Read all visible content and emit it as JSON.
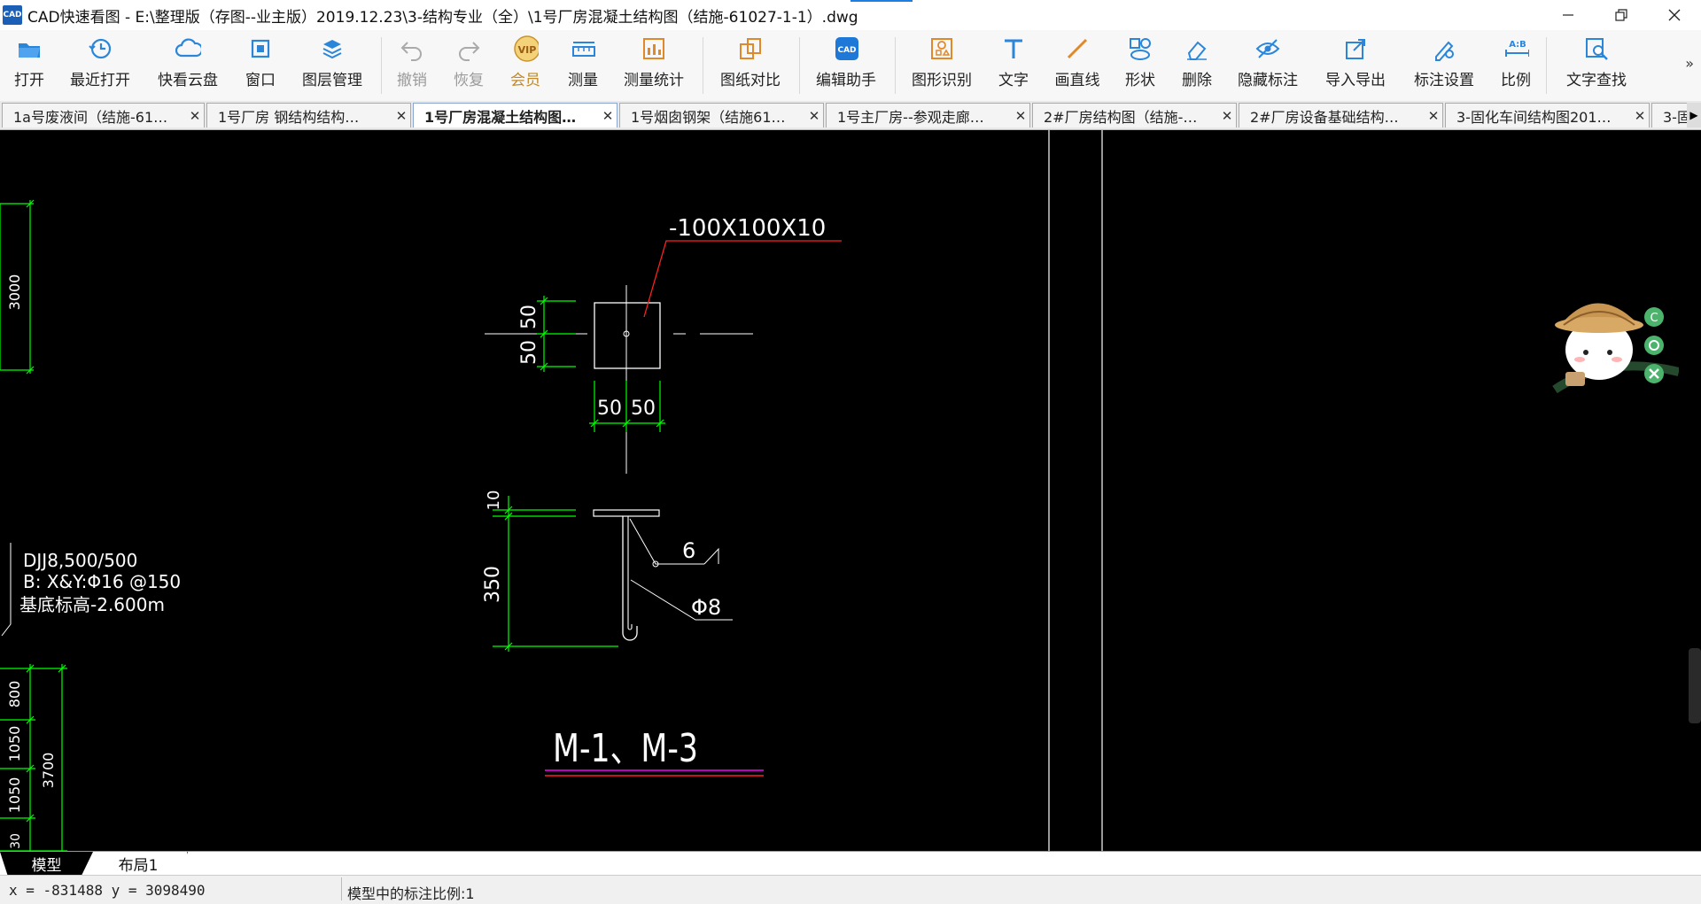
{
  "window": {
    "logo": "CAD",
    "title": "CAD快速看图 - E:\\整理版（存图--业主版）2019.12.23\\3-结构专业（全）\\1号厂房混凝土结构图（结施-61027-1-1）.dwg",
    "controls": [
      "minimize-icon",
      "restore-icon",
      "close-icon"
    ]
  },
  "toolbar": {
    "items": [
      {
        "label": "打开",
        "icon": "folder-open-icon",
        "enabled": true
      },
      {
        "label": "最近打开",
        "icon": "recent-clock-icon",
        "enabled": true
      },
      {
        "label": "快看云盘",
        "icon": "cloud-icon",
        "enabled": true
      },
      {
        "label": "窗口",
        "icon": "window-icon",
        "enabled": true
      },
      {
        "label": "图层管理",
        "icon": "layers-icon",
        "enabled": true
      },
      {
        "label": "撤销",
        "icon": "undo-icon",
        "enabled": false
      },
      {
        "label": "恢复",
        "icon": "redo-icon",
        "enabled": false
      },
      {
        "label": "会员",
        "icon": "vip-badge-icon",
        "badge": "VIP",
        "enabled": true
      },
      {
        "label": "测量",
        "icon": "ruler-icon",
        "enabled": true
      },
      {
        "label": "测量统计",
        "icon": "measure-stats-icon",
        "enabled": true
      },
      {
        "label": "图纸对比",
        "icon": "compare-icon",
        "enabled": true
      },
      {
        "label": "编辑助手",
        "icon": "cad-edit-icon",
        "enabled": true
      },
      {
        "label": "图形识别",
        "icon": "shape-recognize-icon",
        "enabled": true
      },
      {
        "label": "文字",
        "icon": "text-t-icon",
        "enabled": true
      },
      {
        "label": "画直线",
        "icon": "line-icon",
        "enabled": true
      },
      {
        "label": "形状",
        "icon": "shapes-icon",
        "enabled": true
      },
      {
        "label": "删除",
        "icon": "eraser-icon",
        "enabled": true
      },
      {
        "label": "隐藏标注",
        "icon": "eye-hide-icon",
        "enabled": true
      },
      {
        "label": "导入导出",
        "icon": "import-export-icon",
        "enabled": true
      },
      {
        "label": "标注设置",
        "icon": "annotation-settings-icon",
        "enabled": true
      },
      {
        "label": "比例",
        "icon": "ratio-icon",
        "badge": "A:B",
        "enabled": true
      },
      {
        "label": "文字查找",
        "icon": "text-search-icon",
        "enabled": true
      }
    ],
    "more": "»"
  },
  "tabs": [
    {
      "label": "1a号废液间（结施-61…",
      "active": false
    },
    {
      "label": "1号厂房  钢结构结构…",
      "active": false
    },
    {
      "label": "1号厂房混凝土结构图…",
      "active": true
    },
    {
      "label": "1号烟囱钢架（结施61…",
      "active": false
    },
    {
      "label": "1号主厂房--参观走廊…",
      "active": false
    },
    {
      "label": "2#厂房结构图（结施-…",
      "active": false
    },
    {
      "label": "2#厂房设备基础结构…",
      "active": false
    },
    {
      "label": "3-固化车间结构图201…",
      "active": false
    },
    {
      "label": "3-固",
      "active": false
    }
  ],
  "tab_close": "✕",
  "drawing": {
    "plate_label": "-100X100X10",
    "dim_50": "50",
    "dim_10": "10",
    "dim_350": "350",
    "weld_size": "6",
    "rebar": "Φ8",
    "detail_title": "M-1、M-3",
    "left_dim_3000": "3000",
    "foundation": {
      "line1": "DJJ8,500/500",
      "line2": "B:  X&Y:Φ16 @150",
      "line3": "基底标高-2.600m"
    },
    "left_dims": {
      "d800": "800",
      "d1050a": "1050",
      "d1050b": "1050",
      "d3700": "3700",
      "d30": "30"
    },
    "colors": {
      "background": "#000000",
      "dimension": "#00ff00",
      "leader": "#ff2020",
      "line": "#ffffff",
      "underline_magenta": "#ff00ff"
    }
  },
  "layout_tabs": [
    "模型",
    "布局1"
  ],
  "status": {
    "coords": "x = -831488  y = 3098490",
    "scale_text": "模型中的标注比例:1"
  }
}
